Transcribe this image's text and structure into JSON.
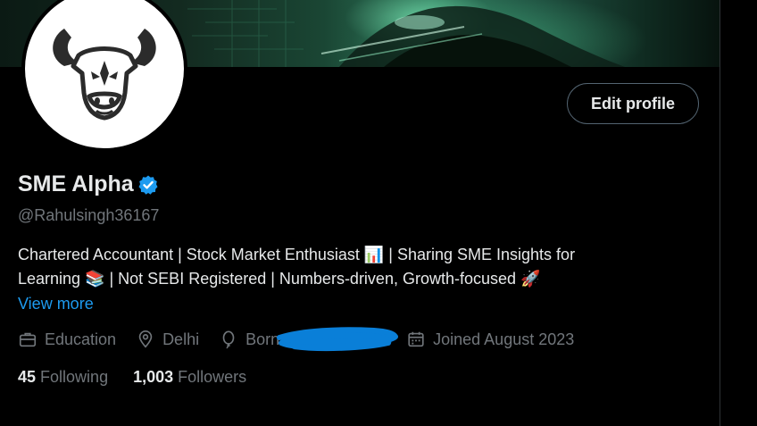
{
  "profile": {
    "display_name": "SME Alpha",
    "handle": "@Rahulsingh36167",
    "bio_line1_a": "Chartered Accountant | Stock Market Enthusiast ",
    "bio_emoji_chart": "📊",
    "bio_line1_b": " | Sharing SME Insights for",
    "bio_line2_a": "Learning ",
    "bio_emoji_books": "📚",
    "bio_line2_b": " | Not SEBI Registered | Numbers-driven, Growth-focused ",
    "bio_emoji_rocket": "🚀",
    "view_more": "View more",
    "category": "Education",
    "location": "Delhi",
    "birthday_partial": "Born",
    "joined": "Joined August 2023"
  },
  "actions": {
    "edit_profile": "Edit profile"
  },
  "stats": {
    "following_count": "45",
    "following_label": "Following",
    "followers_count": "1,003",
    "followers_label": "Followers"
  },
  "icons": {
    "verified": "verified-badge-icon",
    "category": "briefcase-icon",
    "location": "location-pin-icon",
    "birthday": "balloon-icon",
    "joined": "calendar-icon",
    "avatar": "bull-head-logo"
  },
  "colors": {
    "background": "#000000",
    "primary_text": "#e7e9ea",
    "secondary_text": "#71767b",
    "link": "#1d9bf0",
    "verified": "#1d9bf0",
    "redaction": "#0a7fd8"
  }
}
